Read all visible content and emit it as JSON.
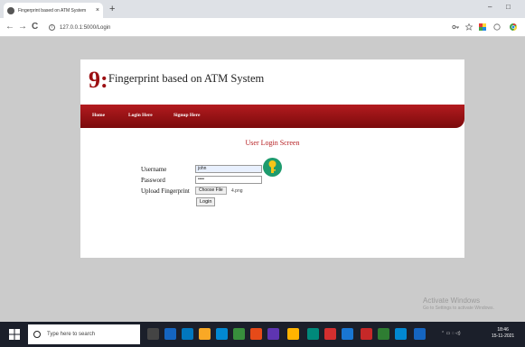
{
  "browser": {
    "tab_title": "Fingerprint based on ATM System",
    "tab_close": "×",
    "new_tab": "+",
    "minimize": "–",
    "maximize": "□",
    "back": "←",
    "forward": "→",
    "reload": "C",
    "address": "127.0.0.1:5000/Login"
  },
  "site": {
    "logo": "9:",
    "title": "Fingerprint based on ATM System",
    "nav": [
      {
        "label": "Home"
      },
      {
        "label": "Login Here"
      },
      {
        "label": "Signup Here"
      }
    ]
  },
  "login": {
    "heading": "User Login Screen",
    "username_label": "Username",
    "username_value": "john",
    "password_label": "Password",
    "password_value": "••••",
    "fingerprint_label": "Upload Fingerprint",
    "choose_file": "Choose File",
    "file_name": "4.png",
    "login_button": "Login"
  },
  "watermark": {
    "line1": "Activate Windows",
    "line2": "Go to Settings to activate Windows."
  },
  "taskbar": {
    "search_placeholder": "Type here to search",
    "time": "18:46",
    "date": "15-11-2021"
  },
  "colors": {
    "brand_red": "#9c0f12",
    "nav_red": "#b31b1f",
    "key_green": "#1e9b6d"
  }
}
